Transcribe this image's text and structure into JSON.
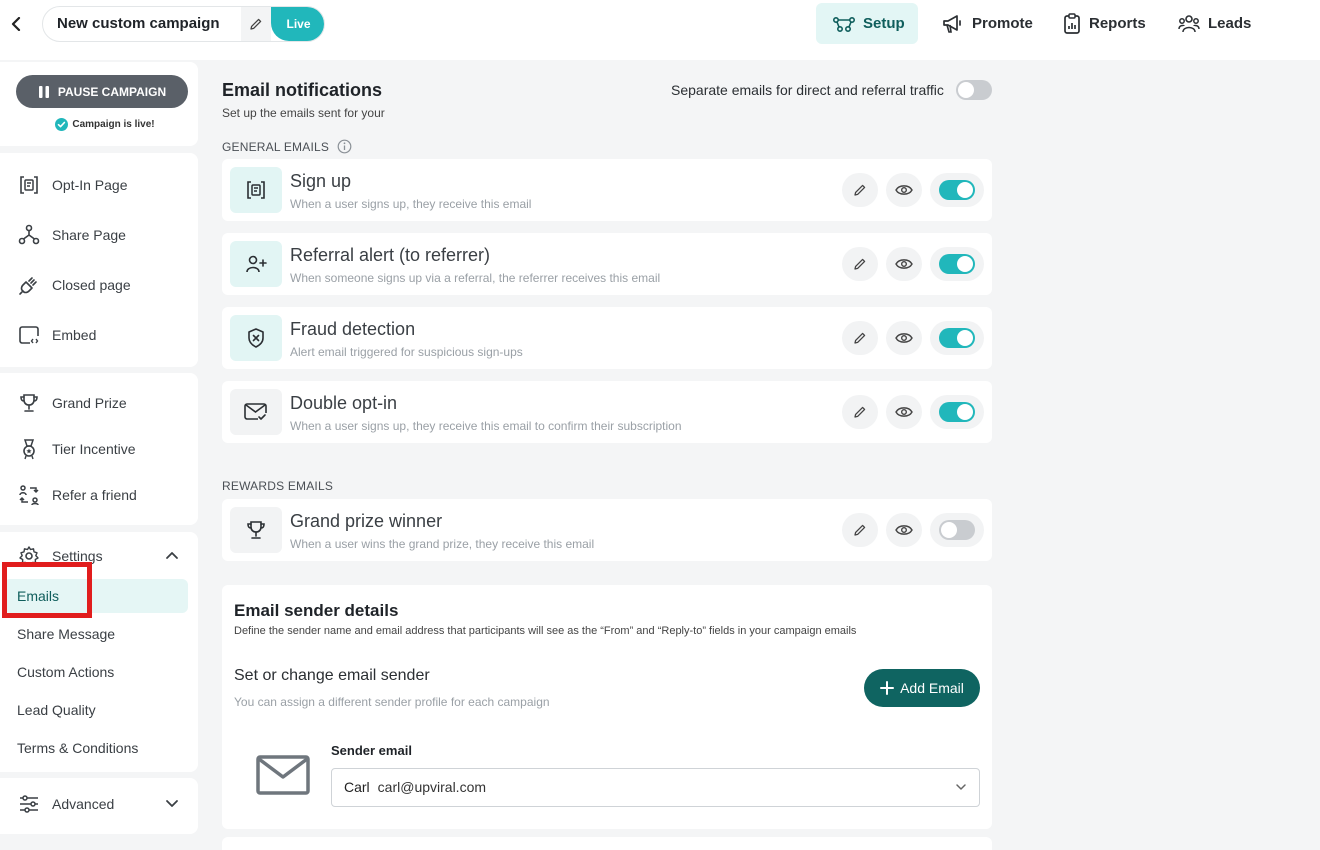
{
  "header": {
    "campaign_name": "New custom campaign",
    "live_label": "Live",
    "nav": [
      {
        "label": "Setup",
        "icon": "setup-icon",
        "active": true
      },
      {
        "label": "Promote",
        "icon": "megaphone-icon"
      },
      {
        "label": "Reports",
        "icon": "clipboard-chart-icon"
      },
      {
        "label": "Leads",
        "icon": "users-icon"
      }
    ]
  },
  "sidebar": {
    "pause_label": "PAUSE CAMPAIGN",
    "live_note": "Campaign is live!",
    "pages": [
      {
        "label": "Opt-In Page",
        "icon": "optin-page-icon"
      },
      {
        "label": "Share Page",
        "icon": "share-nodes-icon"
      },
      {
        "label": "Closed page",
        "icon": "unplugged-icon"
      },
      {
        "label": "Embed",
        "icon": "embed-icon"
      }
    ],
    "rewards": [
      {
        "label": "Grand Prize",
        "icon": "trophy-icon"
      },
      {
        "label": "Tier Incentive",
        "icon": "medal-icon"
      },
      {
        "label": "Refer a friend",
        "icon": "refer-icon"
      }
    ],
    "settings_label": "Settings",
    "settings_items": [
      "Emails",
      "Share Message",
      "Custom Actions",
      "Lead Quality",
      "Terms & Conditions"
    ],
    "active_settings_item": "Emails",
    "advanced_label": "Advanced"
  },
  "main": {
    "title": "Email notifications",
    "subtitle": "Set up the emails sent for your",
    "separate_label": "Separate emails for direct and referral traffic",
    "separate_on": false,
    "general_label": "GENERAL EMAILS",
    "general_emails": [
      {
        "title": "Sign up",
        "desc": "When a user signs up, they receive this email",
        "icon": "signup-form-icon",
        "on": true
      },
      {
        "title": "Referral alert (to referrer)",
        "desc": "When someone signs up via a referral, the referrer receives this email",
        "icon": "user-plus-icon",
        "on": true
      },
      {
        "title": "Fraud detection",
        "desc": "Alert email triggered for suspicious sign-ups",
        "icon": "shield-x-icon",
        "on": true
      },
      {
        "title": "Double opt-in",
        "desc": "When a user signs up, they receive this email to confirm their subscription",
        "icon": "mail-check-icon",
        "on": true
      }
    ],
    "rewards_label": "REWARDS EMAILS",
    "rewards_emails": [
      {
        "title": "Grand prize winner",
        "desc": "When a user wins the grand prize, they receive this email",
        "icon": "trophy-icon",
        "on": false
      }
    ]
  },
  "sender": {
    "title": "Email sender details",
    "desc": "Define the sender name and email address that participants will see as the “From” and “Reply-to” fields in your campaign emails",
    "change_title": "Set or change email sender",
    "change_desc": "You can assign a different sender profile for each campaign",
    "add_label": "Add Email",
    "sender_label": "Sender email",
    "sender_name": "Carl",
    "sender_email": "carl@upviral.com"
  },
  "colors": {
    "accent": "#21b7bb",
    "dark_accent": "#0f6461",
    "highlight": "#e11d1d"
  }
}
